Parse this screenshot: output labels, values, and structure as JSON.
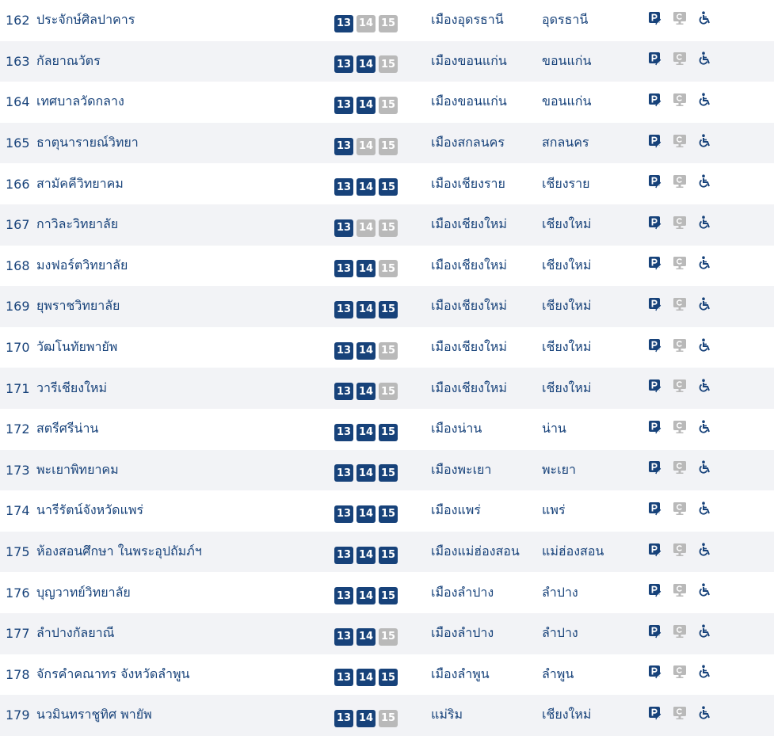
{
  "colors": {
    "primary": "#17427a",
    "inactive": "#b9b9b9",
    "row_alt": "#f2f3f6"
  },
  "icons": {
    "parking": "parking-icon",
    "computer": "computer-icon",
    "wheelchair": "wheelchair-icon"
  },
  "rows": [
    {
      "num": "162",
      "name": "ประจักษ์ศิลปาคาร",
      "grades": [
        {
          "label": "13",
          "active": true
        },
        {
          "label": "14",
          "active": false
        },
        {
          "label": "15",
          "active": false
        }
      ],
      "district": "เมืองอุดรธานี",
      "province": "อุดรธานี"
    },
    {
      "num": "163",
      "name": "กัลยาณวัตร",
      "grades": [
        {
          "label": "13",
          "active": true
        },
        {
          "label": "14",
          "active": true
        },
        {
          "label": "15",
          "active": false
        }
      ],
      "district": "เมืองขอนแก่น",
      "province": "ขอนแก่น"
    },
    {
      "num": "164",
      "name": "เทศบาลวัดกลาง",
      "grades": [
        {
          "label": "13",
          "active": true
        },
        {
          "label": "14",
          "active": true
        },
        {
          "label": "15",
          "active": false
        }
      ],
      "district": "เมืองขอนแก่น",
      "province": "ขอนแก่น"
    },
    {
      "num": "165",
      "name": "ธาตุนารายณ์วิทยา",
      "grades": [
        {
          "label": "13",
          "active": true
        },
        {
          "label": "14",
          "active": false
        },
        {
          "label": "15",
          "active": false
        }
      ],
      "district": "เมืองสกลนคร",
      "province": "สกลนคร"
    },
    {
      "num": "166",
      "name": "สามัคคีวิทยาคม",
      "grades": [
        {
          "label": "13",
          "active": true
        },
        {
          "label": "14",
          "active": true
        },
        {
          "label": "15",
          "active": true
        }
      ],
      "district": "เมืองเชียงราย",
      "province": "เชียงราย"
    },
    {
      "num": "167",
      "name": "กาวิละวิทยาลัย",
      "grades": [
        {
          "label": "13",
          "active": true
        },
        {
          "label": "14",
          "active": false
        },
        {
          "label": "15",
          "active": false
        }
      ],
      "district": "เมืองเชียงใหม่",
      "province": "เชียงใหม่"
    },
    {
      "num": "168",
      "name": "มงฟอร์ตวิทยาลัย",
      "grades": [
        {
          "label": "13",
          "active": true
        },
        {
          "label": "14",
          "active": true
        },
        {
          "label": "15",
          "active": false
        }
      ],
      "district": "เมืองเชียงใหม่",
      "province": "เชียงใหม่"
    },
    {
      "num": "169",
      "name": "ยุพราชวิทยาลัย",
      "grades": [
        {
          "label": "13",
          "active": true
        },
        {
          "label": "14",
          "active": true
        },
        {
          "label": "15",
          "active": true
        }
      ],
      "district": "เมืองเชียงใหม่",
      "province": "เชียงใหม่"
    },
    {
      "num": "170",
      "name": "วัฒโนทัยพายัพ",
      "grades": [
        {
          "label": "13",
          "active": true
        },
        {
          "label": "14",
          "active": true
        },
        {
          "label": "15",
          "active": false
        }
      ],
      "district": "เมืองเชียงใหม่",
      "province": "เชียงใหม่"
    },
    {
      "num": "171",
      "name": "วารีเชียงใหม่",
      "grades": [
        {
          "label": "13",
          "active": true
        },
        {
          "label": "14",
          "active": true
        },
        {
          "label": "15",
          "active": false
        }
      ],
      "district": "เมืองเชียงใหม่",
      "province": "เชียงใหม่"
    },
    {
      "num": "172",
      "name": "สตรีศรีน่าน",
      "grades": [
        {
          "label": "13",
          "active": true
        },
        {
          "label": "14",
          "active": true
        },
        {
          "label": "15",
          "active": true
        }
      ],
      "district": "เมืองน่าน",
      "province": "น่าน"
    },
    {
      "num": "173",
      "name": "พะเยาพิทยาคม",
      "grades": [
        {
          "label": "13",
          "active": true
        },
        {
          "label": "14",
          "active": true
        },
        {
          "label": "15",
          "active": true
        }
      ],
      "district": "เมืองพะเยา",
      "province": "พะเยา"
    },
    {
      "num": "174",
      "name": "นารีรัตน์จังหวัดแพร่",
      "grades": [
        {
          "label": "13",
          "active": true
        },
        {
          "label": "14",
          "active": true
        },
        {
          "label": "15",
          "active": true
        }
      ],
      "district": "เมืองแพร่",
      "province": "แพร่"
    },
    {
      "num": "175",
      "name": "ห้องสอนศึกษา ในพระอุปถัมภ์ฯ",
      "grades": [
        {
          "label": "13",
          "active": true
        },
        {
          "label": "14",
          "active": true
        },
        {
          "label": "15",
          "active": true
        }
      ],
      "district": "เมืองแม่ฮ่องสอน",
      "province": "แม่ฮ่องสอน"
    },
    {
      "num": "176",
      "name": "บุญวาทย์วิทยาลัย",
      "grades": [
        {
          "label": "13",
          "active": true
        },
        {
          "label": "14",
          "active": true
        },
        {
          "label": "15",
          "active": true
        }
      ],
      "district": "เมืองลำปาง",
      "province": "ลำปาง"
    },
    {
      "num": "177",
      "name": "ลำปางกัลยาณี",
      "grades": [
        {
          "label": "13",
          "active": true
        },
        {
          "label": "14",
          "active": true
        },
        {
          "label": "15",
          "active": false
        }
      ],
      "district": "เมืองลำปาง",
      "province": "ลำปาง"
    },
    {
      "num": "178",
      "name": "จักรคำคณาทร จังหวัดลำพูน",
      "grades": [
        {
          "label": "13",
          "active": true
        },
        {
          "label": "14",
          "active": true
        },
        {
          "label": "15",
          "active": true
        }
      ],
      "district": "เมืองลำพูน",
      "province": "ลำพูน"
    },
    {
      "num": "179",
      "name": "นวมินทราชูทิศ พายัพ",
      "grades": [
        {
          "label": "13",
          "active": true
        },
        {
          "label": "14",
          "active": true
        },
        {
          "label": "15",
          "active": false
        }
      ],
      "district": "แม่ริม",
      "province": "เชียงใหม่"
    }
  ]
}
